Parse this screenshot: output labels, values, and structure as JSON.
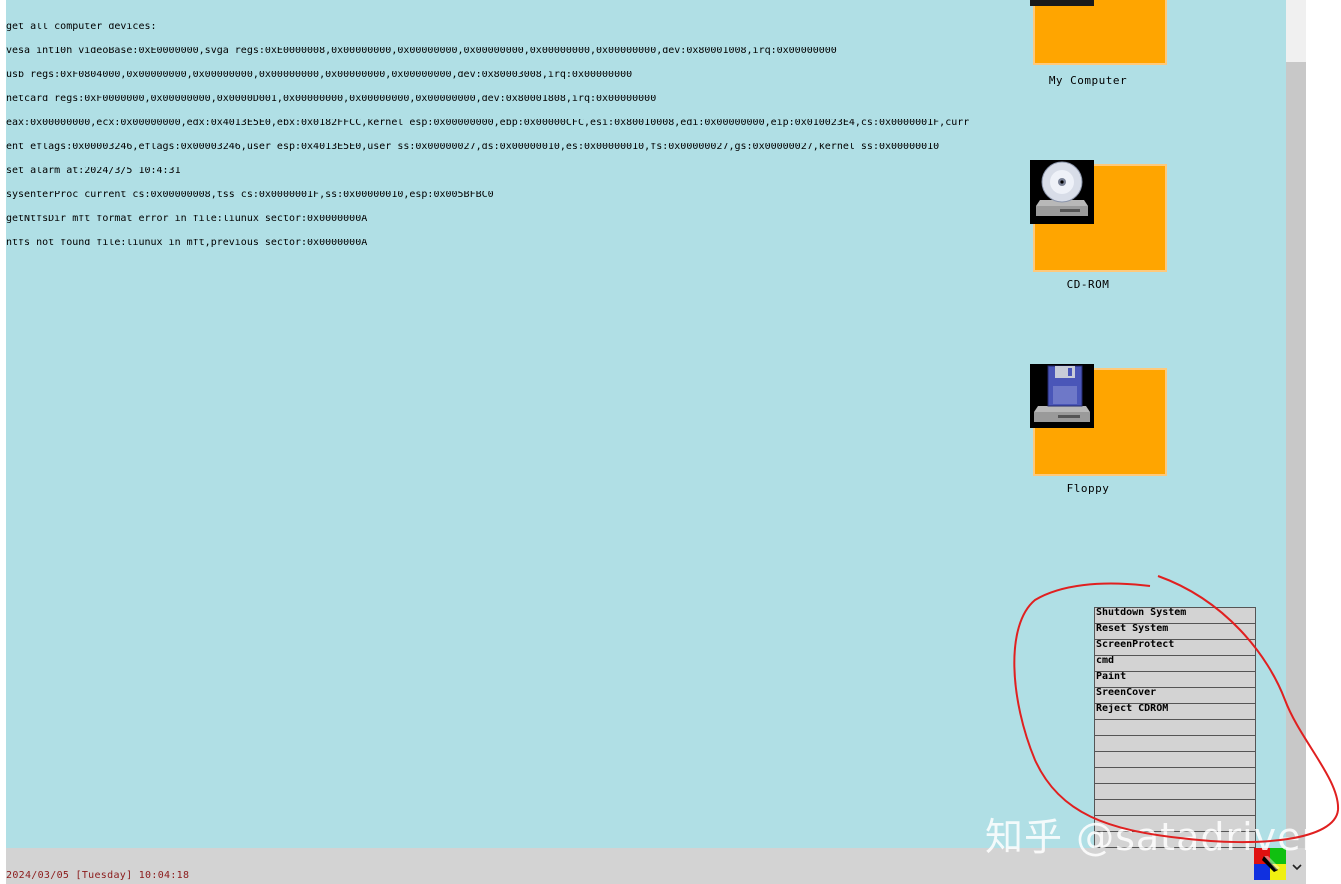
{
  "console": {
    "lines": [
      "get all computer devices:",
      "vesa int10h videoBase:0xE0000000,svga regs:0xE0000008,0x00000000,0x00000000,0x00000000,0x00000000,0x00000000,dev:0x80001008,irq:0x00000000",
      "usb regs:0xF0804000,0x00000000,0x00000000,0x00000000,0x00000000,0x00000000,dev:0x80003008,irq:0x00000000",
      "netcard regs:0xF0000000,0x00000000,0x0000D001,0x00000000,0x00000000,0x00000000,dev:0x80001808,irq:0x00000000",
      "eax:0x00000000,ecx:0x00000000,edx:0x4013E5E0,ebx:0x0182FFCC,kernel esp:0x00000000,ebp:0x00000CFC,esi:0x80010008,edi:0x00000000,eip:0x010023E4,cs:0x0000001F,curr",
      "ent eflags:0x00003246,eflags:0x00003246,user esp:0x4013E5E0,user ss:0x00000027,ds:0x00000010,es:0x00000010,fs:0x00000027,gs:0x00000027,kernel ss:0x00000010",
      "set alarm at:2024/3/5 10:4:31",
      "sysenterProc current cs:0x00000008,tss cs:0x0000001F,ss:0x00000010,esp:0x005BFBC0",
      "getNtfsDir mft format error in file:liunux sector:0x0000000A",
      "ntfs not found file:liunux in mft,previous sector:0x0000000A"
    ]
  },
  "desktop": {
    "background": "#b0dfe5",
    "icons": [
      {
        "label": "My Computer",
        "icon": "computer-icon"
      },
      {
        "label": "CD-ROM",
        "icon": "cdrom-drive-icon"
      },
      {
        "label": "Floppy",
        "icon": "floppy-drive-icon"
      }
    ]
  },
  "menu": {
    "items": [
      "Shutdown System",
      "Reset System",
      "ScreenProtect",
      "cmd",
      "Paint",
      "SreenCover",
      "Reject CDROM",
      "",
      "",
      "",
      "",
      "",
      "",
      "",
      ""
    ]
  },
  "taskbar": {
    "clock": "2024/03/05 [Tuesday] 10:04:18",
    "start_icon": "windows-logo-icon",
    "scroll_icon": "chevron-down-icon"
  },
  "watermark": "知乎 @satadriver",
  "colors": {
    "tile": "#ffa500",
    "menu_bg": "#d3d3d3",
    "clock_text": "#8b1a1a",
    "annotation": "#e02020"
  }
}
